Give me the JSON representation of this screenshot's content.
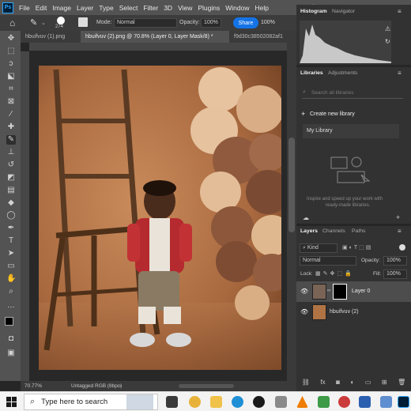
{
  "menubar": {
    "logo": "Ps",
    "items": [
      "File",
      "Edit",
      "Image",
      "Layer",
      "Type",
      "Select",
      "Filter",
      "3D",
      "View",
      "Plugins",
      "Window",
      "Help"
    ]
  },
  "options_bar": {
    "mode_label": "Mode:",
    "mode_value": "Normal",
    "brush_size": "274",
    "opacity_label": "Opacity:",
    "opacity_value": "100%",
    "share_label": "Share",
    "zoom_value": "100%"
  },
  "tabs": [
    {
      "label": "hbuifvuv (1).png",
      "active": false
    },
    {
      "label": "hbuifvuv (2).png @ 70.8% (Layer 0, Layer Mask/8) *",
      "active": true
    },
    {
      "label": "f9d30c38502082af1",
      "active": false
    }
  ],
  "status": {
    "zoom": "70.77%",
    "profile": "Untagged RGB (8bpc)"
  },
  "histogram": {
    "tabs": [
      "Histogram",
      "Navigator"
    ]
  },
  "libraries": {
    "tabs": [
      "Libraries",
      "Adjustments"
    ],
    "search_placeholder": "Search all libraries",
    "create_label": "Create new library",
    "my_library": "My Library",
    "empty_text_line1": "Inspire and speed up your work with",
    "empty_text_line2": "ready-made libraries."
  },
  "layers": {
    "tabs": [
      "Layers",
      "Channels",
      "Paths"
    ],
    "filter_kind": "Kind",
    "blend_mode": "Normal",
    "opacity_label": "Opacity:",
    "opacity_value": "100%",
    "lock_label": "Lock:",
    "fill_label": "Fill:",
    "fill_value": "100%",
    "items": [
      {
        "name": "Layer 0",
        "selected": true
      },
      {
        "name": "hbuifvuv (2)",
        "selected": false
      }
    ]
  },
  "taskbar": {
    "search_placeholder": "Type here to search"
  },
  "colors": {
    "accent": "#1473e6",
    "ps_logo": "#31a8ff",
    "panel_bg": "#535353",
    "dark_bg": "#262626"
  }
}
